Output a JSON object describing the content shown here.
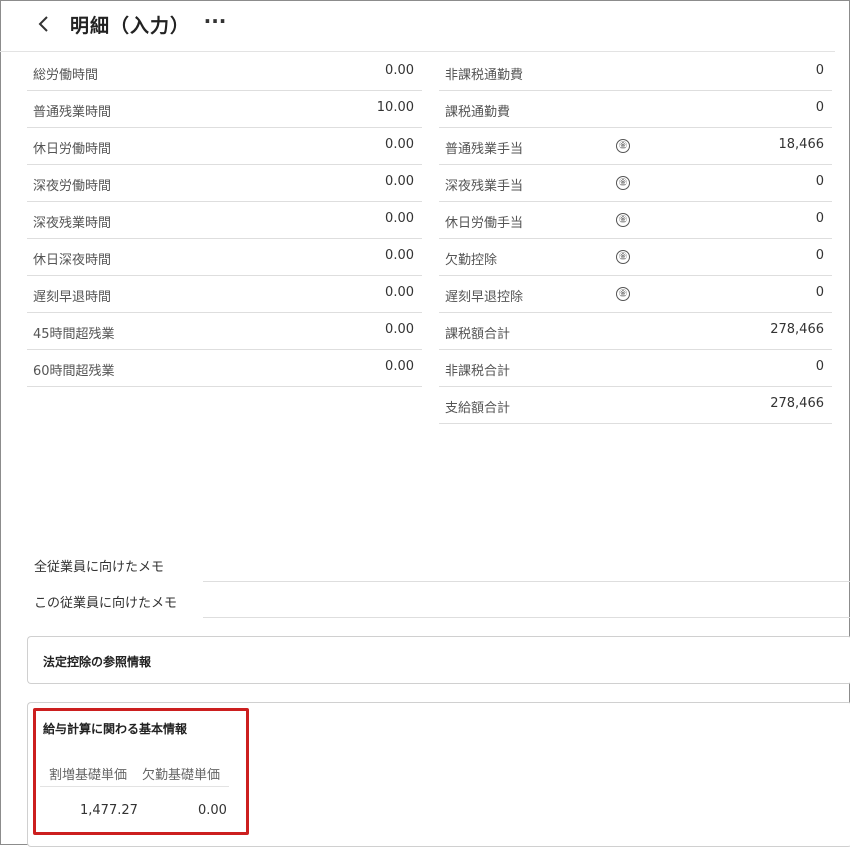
{
  "header": {
    "title": "明細（入力）",
    "back_icon": "chevron-left-icon",
    "more_icon": "more-icon",
    "more_label": "···"
  },
  "left_table": [
    {
      "label": "総労働時間",
      "value": "0.00"
    },
    {
      "label": "普通残業時間",
      "value": "10.00"
    },
    {
      "label": "休日労働時間",
      "value": "0.00"
    },
    {
      "label": "深夜労働時間",
      "value": "0.00"
    },
    {
      "label": "深夜残業時間",
      "value": "0.00"
    },
    {
      "label": "休日深夜時間",
      "value": "0.00"
    },
    {
      "label": "遅刻早退時間",
      "value": "0.00"
    },
    {
      "label": "45時間超残業",
      "value": "0.00"
    },
    {
      "label": "60時間超残業",
      "value": "0.00"
    }
  ],
  "right_table": [
    {
      "label": "非課税通勤費",
      "value": "0",
      "yen_badge": false
    },
    {
      "label": "課税通勤費",
      "value": "0",
      "yen_badge": false
    },
    {
      "label": "普通残業手当",
      "value": "18,466",
      "yen_badge": true
    },
    {
      "label": "深夜残業手当",
      "value": "0",
      "yen_badge": true
    },
    {
      "label": "休日労働手当",
      "value": "0",
      "yen_badge": true
    },
    {
      "label": "欠勤控除",
      "value": "0",
      "yen_badge": true
    },
    {
      "label": "遅刻早退控除",
      "value": "0",
      "yen_badge": true
    },
    {
      "label": "課税額合計",
      "value": "278,466",
      "yen_badge": false
    },
    {
      "label": "非課税合計",
      "value": "0",
      "yen_badge": false
    },
    {
      "label": "支給額合計",
      "value": "278,466",
      "yen_badge": false
    }
  ],
  "yen_badge_label": "㊎",
  "memos": {
    "all_employees_label": "全従業員に向けたメモ",
    "this_employee_label": "この従業員に向けたメモ"
  },
  "legal_deduction": {
    "title": "法定控除の参照情報"
  },
  "basic_info": {
    "title": "給与計算に関わる基本情報",
    "columns": [
      "割増基礎単価",
      "欠勤基礎単価"
    ],
    "values": [
      "1,477.27",
      "0.00"
    ]
  },
  "colors": {
    "highlight": "#cc1f1f",
    "border": "#d0d0d0",
    "row_divider": "#dedede"
  }
}
